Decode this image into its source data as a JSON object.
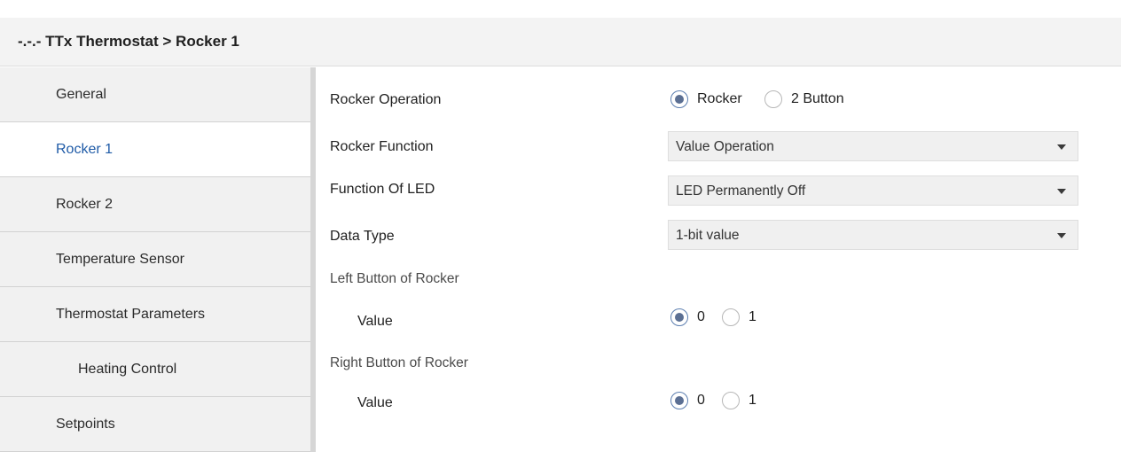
{
  "header": {
    "title": "-.-.- TTx Thermostat > Rocker 1"
  },
  "sidebar": {
    "items": [
      {
        "label": "General"
      },
      {
        "label": "Rocker 1"
      },
      {
        "label": "Rocker 2"
      },
      {
        "label": "Temperature Sensor"
      },
      {
        "label": "Thermostat Parameters"
      },
      {
        "label": "Heating Control"
      },
      {
        "label": "Setpoints"
      }
    ],
    "active_item": "Rocker 1"
  },
  "form": {
    "rocker_operation": {
      "label": "Rocker Operation",
      "options": [
        "Rocker",
        "2 Button"
      ],
      "selected": "Rocker"
    },
    "rocker_function": {
      "label": "Rocker Function",
      "value": "Value Operation"
    },
    "function_of_led": {
      "label": "Function Of LED",
      "value": "LED Permanently Off"
    },
    "data_type": {
      "label": "Data Type",
      "value": "1-bit value"
    },
    "left_button": {
      "section_label": "Left Button of Rocker",
      "value_label": "Value",
      "options": [
        "0",
        "1"
      ],
      "selected": "0"
    },
    "right_button": {
      "section_label": "Right Button of Rocker",
      "value_label": "Value",
      "options": [
        "0",
        "1"
      ],
      "selected": "0"
    }
  },
  "icons": {
    "dropdown": "chevron-down-icon",
    "radio_selected": "radio-checked",
    "radio_unselected": "radio-unchecked"
  },
  "colors": {
    "active_link": "#1f5ba7",
    "sidebar_bg": "#f1f1f1",
    "header_bg": "#f3f3f3",
    "radio_fill": "#5b6f93"
  }
}
